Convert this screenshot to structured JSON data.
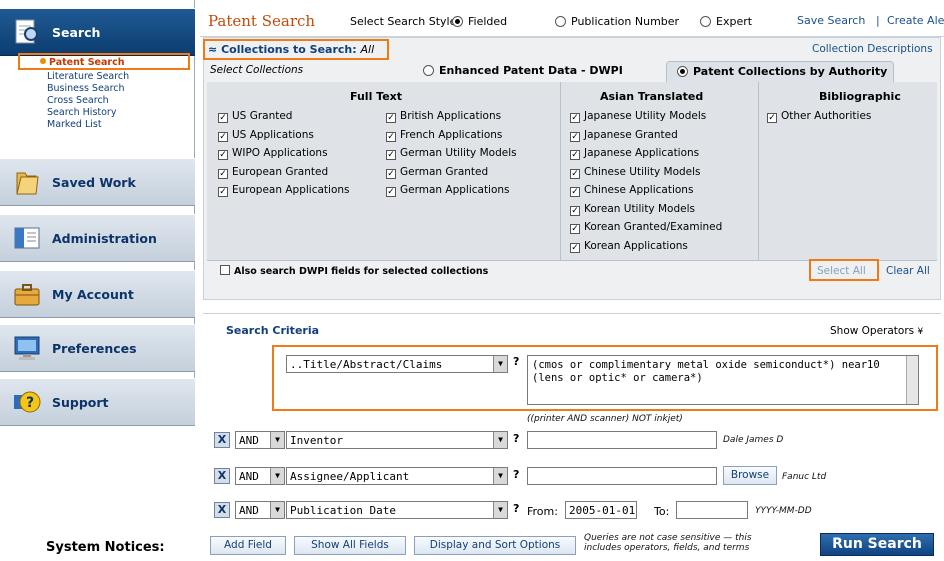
{
  "sidebar": {
    "sections": [
      {
        "label": "Search",
        "icon": "search-document-icon"
      },
      {
        "label": "Saved Work",
        "icon": "folder-icon"
      },
      {
        "label": "Administration",
        "icon": "admin-list-icon"
      },
      {
        "label": "My Account",
        "icon": "briefcase-icon"
      },
      {
        "label": "Preferences",
        "icon": "monitor-icon"
      },
      {
        "label": "Support",
        "icon": "help-icon"
      }
    ],
    "search_links": [
      "Patent Search",
      "Literature Search",
      "Business Search",
      "Cross Search",
      "Search History",
      "Marked List"
    ],
    "system_notices": "System Notices:"
  },
  "header": {
    "title": "Patent Search",
    "style_label": "Select Search Style:",
    "styles": [
      "Fielded",
      "Publication Number",
      "Expert"
    ],
    "selected_style": "Fielded",
    "save_search": "Save Search",
    "separator": "|",
    "create_alert": "Create Ale"
  },
  "collections": {
    "heading": "Collections to Search:",
    "heading_value": "All",
    "collection_descriptions": "Collection Descriptions",
    "select_label": "Select Collections",
    "tabs": [
      "Enhanced Patent Data - DWPI",
      "Patent Collections by Authority"
    ],
    "selected_tab": "Patent Collections by Authority",
    "groups": {
      "full_text": "Full Text",
      "asian": "Asian Translated",
      "biblio": "Bibliographic"
    },
    "full_text_col1": [
      "US Granted",
      "US Applications",
      "WIPO Applications",
      "European Granted",
      "European Applications"
    ],
    "full_text_col2": [
      "British Applications",
      "French Applications",
      "German Utility Models",
      "German Granted",
      "German Applications"
    ],
    "asian_items": [
      "Japanese Utility Models",
      "Japanese Granted",
      "Japanese Applications",
      "Chinese Utility Models",
      "Chinese Applications",
      "Korean Utility Models",
      "Korean Granted/Examined",
      "Korean Applications"
    ],
    "biblio_items": [
      "Other Authorities"
    ],
    "dwpi_option": "Also search DWPI fields for selected collections",
    "select_all": "Select All",
    "clear_all": "Clear All"
  },
  "criteria": {
    "heading": "Search Criteria",
    "show_operators": "Show Operators",
    "row1": {
      "field": "..Title/Abstract/Claims",
      "query": "(cmos or complimentary metal oxide semiconduct*) near10 (lens or optic* or camera*)",
      "hint": "((printer AND scanner) NOT inkjet)"
    },
    "row2": {
      "op": "AND",
      "field": "Inventor",
      "value": "",
      "hint": "Dale James D"
    },
    "row3": {
      "op": "AND",
      "field": "Assignee/Applicant",
      "value": "",
      "browse": "Browse",
      "hint": "Fanuc Ltd"
    },
    "row4": {
      "op": "AND",
      "field": "Publication Date",
      "from_label": "From:",
      "from_value": "2005-01-01",
      "to_label": "To:",
      "to_value": "",
      "hint": "YYYY-MM-DD"
    },
    "help": "?",
    "remove": "X",
    "add_field": "Add Field",
    "show_all_fields": "Show All Fields",
    "display_sort": "Display and Sort Options",
    "case_note_1": "Queries are not case sensitive — this",
    "case_note_2": "includes operators, fields, and terms",
    "run_search": "Run Search"
  },
  "colors": {
    "nav_active": "#1f5a93",
    "highlight": "#f07a15",
    "link": "#1a4f8c"
  }
}
